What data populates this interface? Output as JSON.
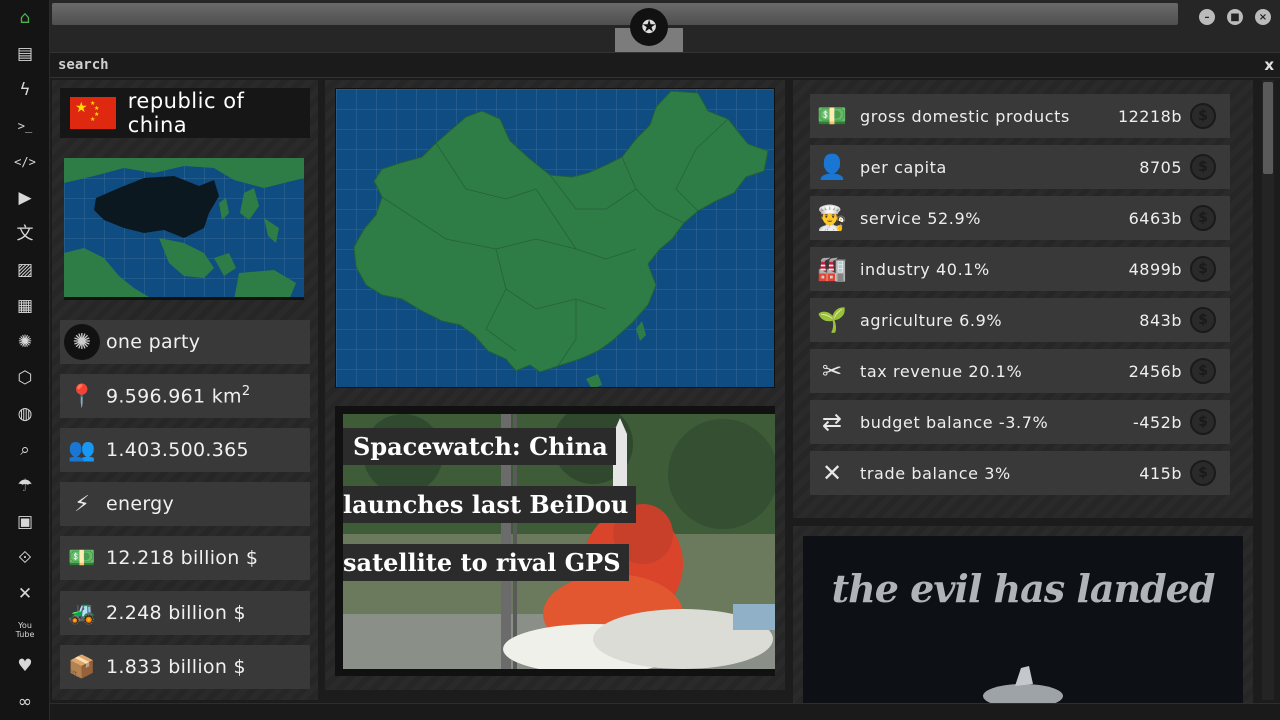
{
  "app": {
    "search_label": "search",
    "close_label": "x"
  },
  "sidebar": {
    "items": [
      {
        "name": "home-icon",
        "glyph": "⌂"
      },
      {
        "name": "document-icon",
        "glyph": "▤"
      },
      {
        "name": "lightning-icon",
        "glyph": "ϟ"
      },
      {
        "name": "terminal-icon",
        "glyph": ">_"
      },
      {
        "name": "code-icon",
        "glyph": "</>"
      },
      {
        "name": "play-icon",
        "glyph": "▶"
      },
      {
        "name": "translate-icon",
        "glyph": "文"
      },
      {
        "name": "image-icon",
        "glyph": "▨"
      },
      {
        "name": "newspaper-icon",
        "glyph": "▦"
      },
      {
        "name": "empire-icon",
        "glyph": "✺"
      },
      {
        "name": "hexagon-icon",
        "glyph": "⬡"
      },
      {
        "name": "globe-icon",
        "glyph": "◍"
      },
      {
        "name": "search-icon",
        "glyph": "⌕"
      },
      {
        "name": "umbrella-icon",
        "glyph": "☂"
      },
      {
        "name": "contact-icon",
        "glyph": "▣"
      },
      {
        "name": "link-icon",
        "glyph": "⟐"
      },
      {
        "name": "expand-icon",
        "glyph": "✕"
      },
      {
        "name": "youtube-icon",
        "glyph": "You Tube"
      },
      {
        "name": "heart-icon",
        "glyph": "♥"
      },
      {
        "name": "infinity-icon",
        "glyph": "∞"
      }
    ]
  },
  "country": {
    "name": "republic of china",
    "stats": [
      {
        "icon": "empire-icon",
        "glyph": "✺",
        "text": "one party"
      },
      {
        "icon": "map-pin-icon",
        "glyph": "📍",
        "text": "9.596.961 km",
        "sup": "2"
      },
      {
        "icon": "people-icon",
        "glyph": "👥",
        "text": "1.403.500.365"
      },
      {
        "icon": "lightning-icon",
        "glyph": "⚡",
        "text": "energy"
      },
      {
        "icon": "money-pallet-icon",
        "glyph": "💵",
        "text": "12.218 billion $"
      },
      {
        "icon": "forklift-money-icon",
        "glyph": "🚜",
        "text": "2.248 billion $"
      },
      {
        "icon": "boxes-icon",
        "glyph": "📦",
        "text": "1.833 billion $"
      }
    ]
  },
  "news": {
    "headline_lines": [
      "Spacewatch: China",
      "launches last BeiDou",
      "satellite to rival GPS"
    ]
  },
  "economy": {
    "rows": [
      {
        "icon": "money-pallet-icon",
        "glyph": "💵",
        "label": "gross domestic products",
        "value": "12218b"
      },
      {
        "icon": "person-icon",
        "glyph": "👤",
        "label": "per capita",
        "value": "8705"
      },
      {
        "icon": "chef-icon",
        "glyph": "👨‍🍳",
        "label": "service 52.9%",
        "value": "6463b"
      },
      {
        "icon": "factory-icon",
        "glyph": "🏭",
        "label": "industry 40.1%",
        "value": "4899b"
      },
      {
        "icon": "sprout-icon",
        "glyph": "🌱",
        "label": "agriculture 6.9%",
        "value": "843b"
      },
      {
        "icon": "scissors-money-icon",
        "glyph": "✂",
        "label": "tax revenue 20.1%",
        "value": "2456b"
      },
      {
        "icon": "exchange-arrows-icon",
        "glyph": "⇄",
        "label": "budget balance -3.7%",
        "value": "-452b"
      },
      {
        "icon": "trade-cross-icon",
        "glyph": "✕",
        "label": "trade balance 3%",
        "value": "415b"
      }
    ],
    "dollar_glyph": "$"
  },
  "ad": {
    "text": "the evil has landed"
  },
  "colors": {
    "accent_green": "#4caf50",
    "map_sea": "#0f4c81",
    "map_land": "#2e7d46",
    "flag_red": "#de2910",
    "flag_star": "#ffde00"
  }
}
